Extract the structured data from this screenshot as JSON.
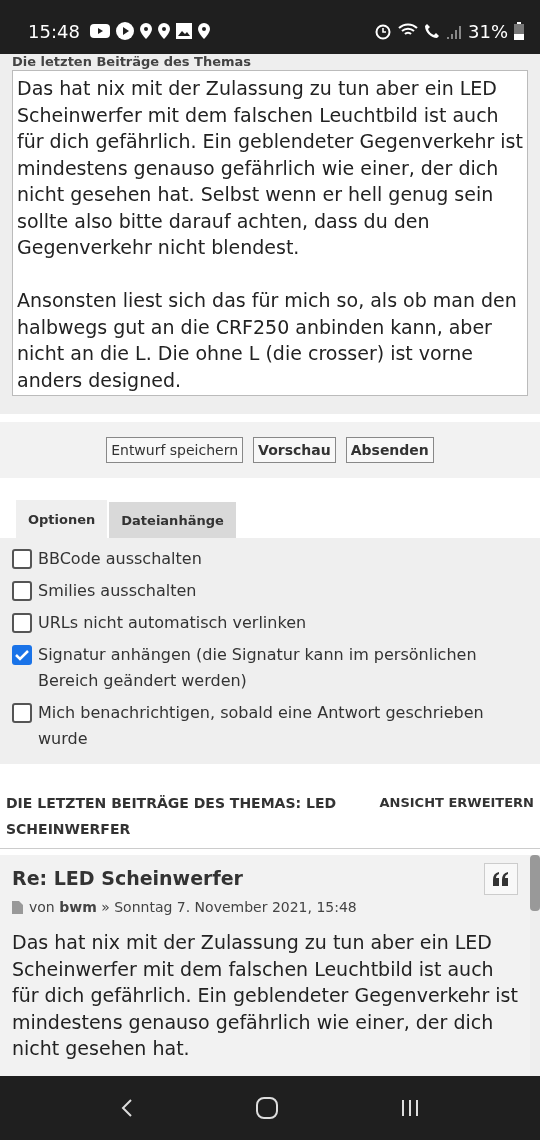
{
  "status_bar": {
    "time": "15:48",
    "battery": "31%"
  },
  "section_label": "Die letzten Beiträge des Themas",
  "message": {
    "value": "Das hat nix mit der Zulassung zu tun aber ein LED Scheinwerfer mit dem falschen Leuchtbild ist auch für dich gefährlich. Ein geblendeter Gegenverkehr ist mindestens genauso gefährlich wie einer, der dich nicht gesehen hat. Selbst wenn er hell genug sein sollte also bitte darauf achten, dass du den Gegenverkehr nicht blendest.\n\nAnsonsten liest sich das für mich so, als ob man den halbwegs gut an die CRF250 anbinden kann, aber nicht an die L. Die ohne L (die crosser) ist vorne anders designed."
  },
  "buttons": [
    {
      "label": "Entwurf speichern",
      "primary": false
    },
    {
      "label": "Vorschau",
      "primary": true
    },
    {
      "label": "Absenden",
      "primary": true
    }
  ],
  "tabs": [
    {
      "label": "Optionen",
      "selected": true
    },
    {
      "label": "Dateianhänge",
      "selected": false
    }
  ],
  "options": [
    {
      "label": "BBCode ausschalten",
      "checked": false
    },
    {
      "label": "Smilies ausschalten",
      "checked": false
    },
    {
      "label": "URLs nicht automatisch verlinken",
      "checked": false
    },
    {
      "label": "Signatur anhängen (die Signatur kann im persönlichen Bereich geändert werden)",
      "checked": true
    },
    {
      "label": "Mich benachrichtigen, sobald eine Antwort geschrieben wurde",
      "checked": false
    }
  ],
  "review": {
    "heading": "DIE LETZTEN BEITRÄGE DES THEMAS: LED SCHEINWERFER",
    "expand_link": "ANSICHT ERWEITERN",
    "post": {
      "title": "Re: LED Scheinwerfer",
      "by": "von",
      "author": "bwm",
      "date": "» Sonntag 7. November 2021, 15:48",
      "body": "Das hat nix mit der Zulassung zu tun aber ein LED Scheinwerfer mit dem falschen Leuchtbild ist auch für dich gefährlich. Ein geblendeter Gegenverkehr ist mindestens genauso gefährlich wie einer, der dich nicht gesehen hat."
    }
  }
}
